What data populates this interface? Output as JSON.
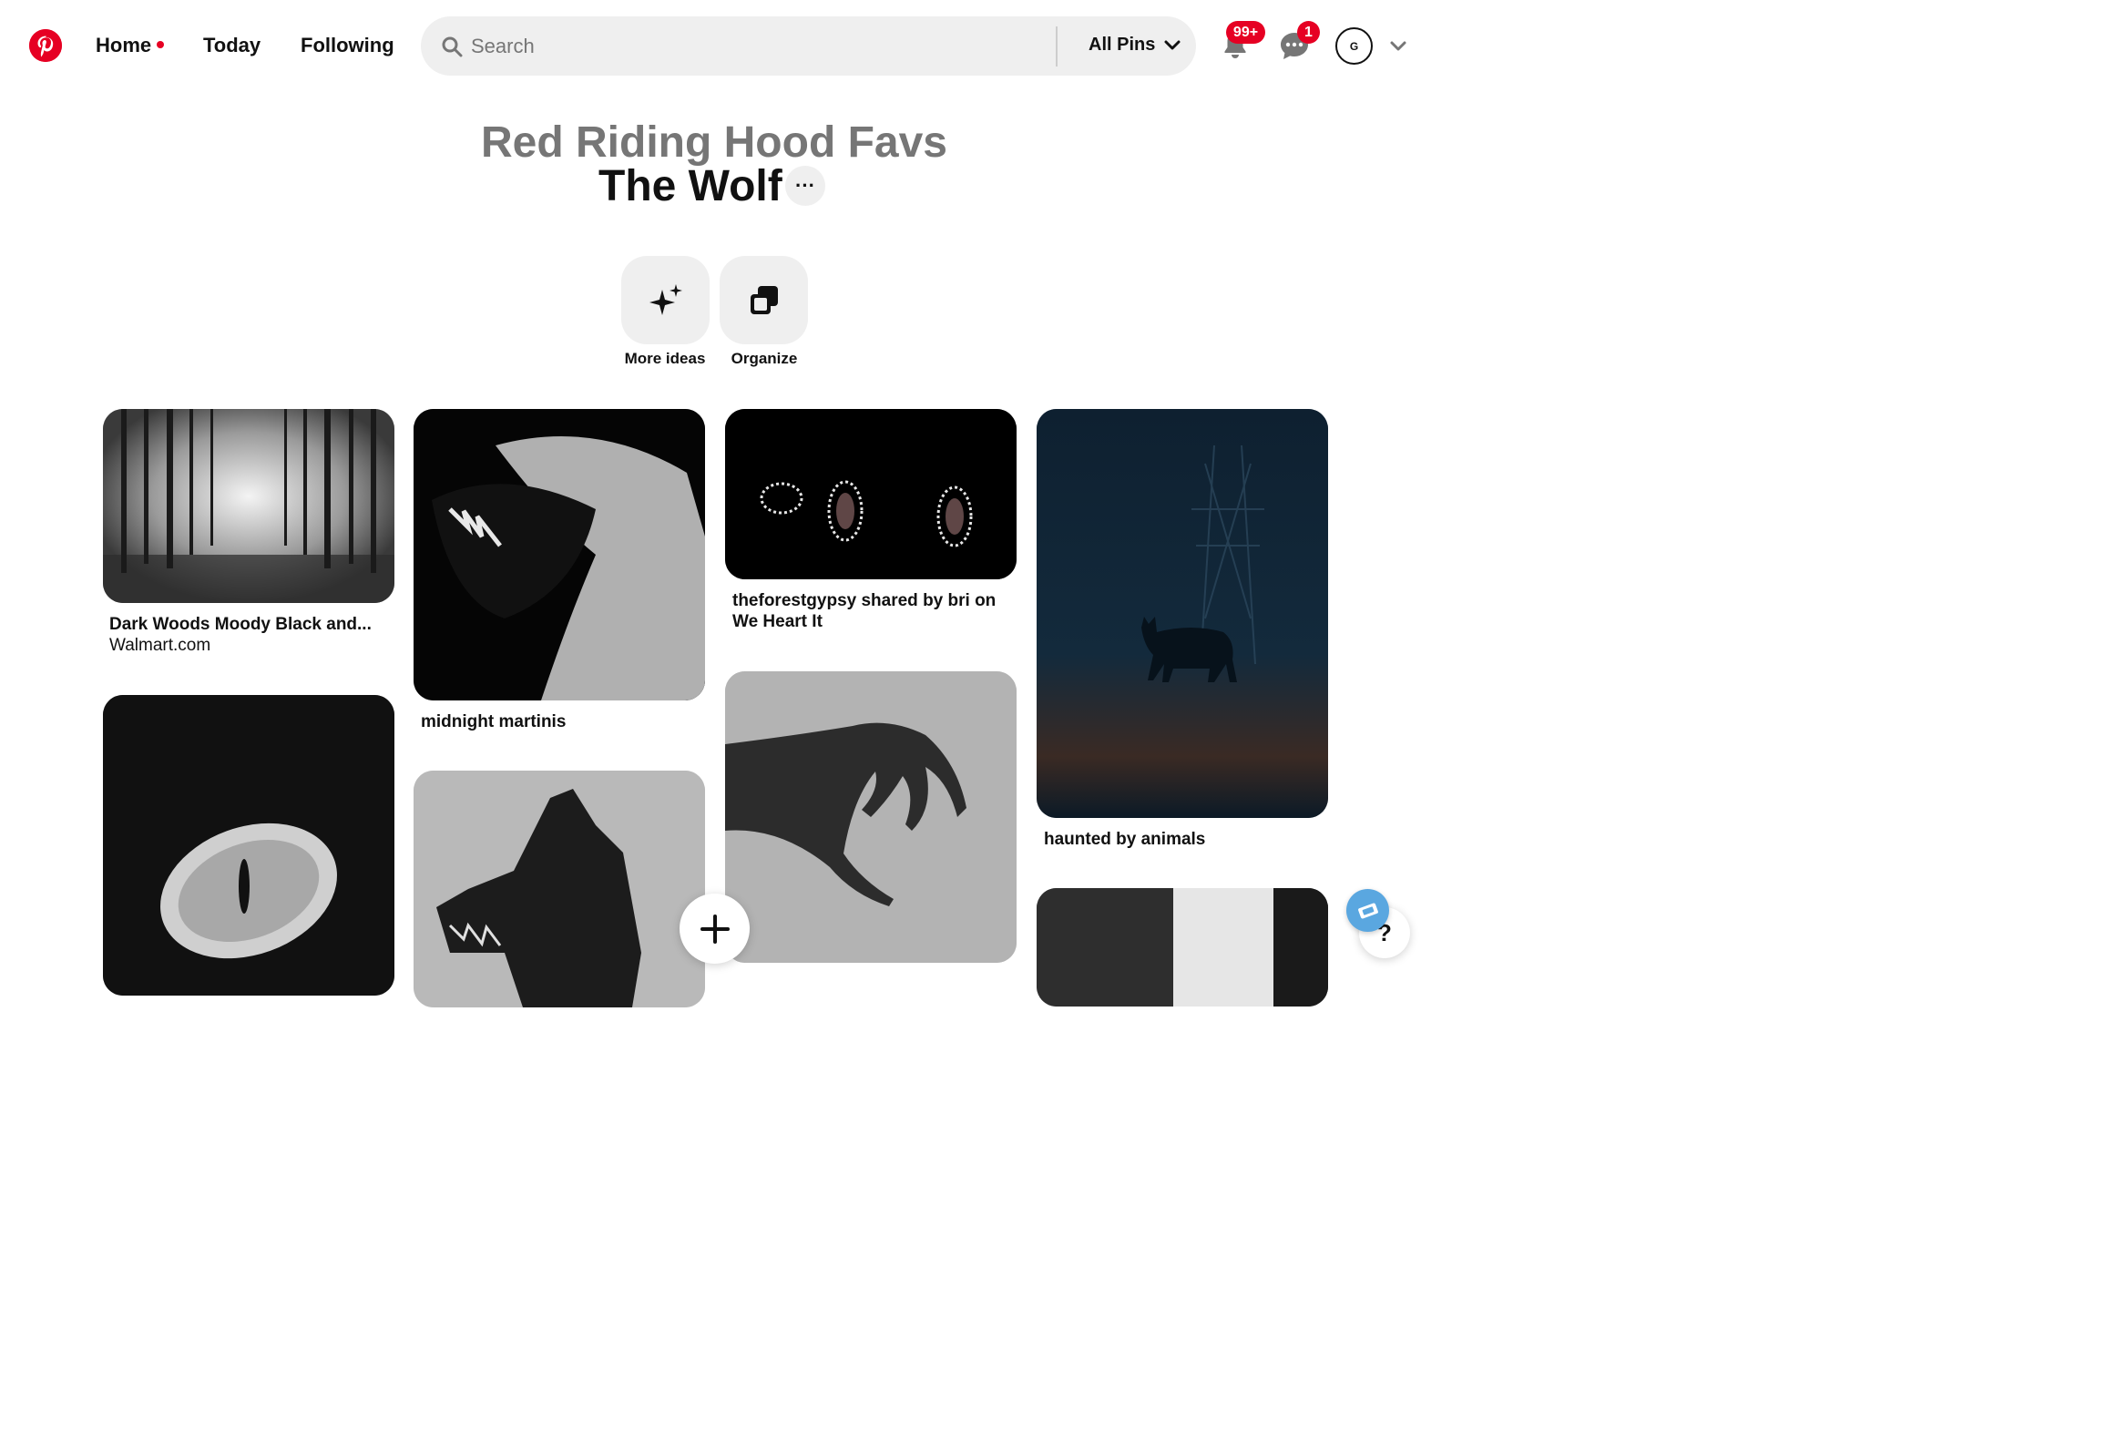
{
  "colors": {
    "brand": "#e60023",
    "text": "#111111",
    "muted": "#767676",
    "chip": "#efefef"
  },
  "header": {
    "logo_icon": "pinterest-logo-icon",
    "nav": {
      "home": "Home",
      "today": "Today",
      "following": "Following"
    },
    "search": {
      "placeholder": "Search",
      "filter": "All Pins"
    },
    "notifications_badge": "99+",
    "messages_badge": "1",
    "avatar_initial": "G"
  },
  "board": {
    "parent": "Red Riding Hood Favs",
    "title": "The Wolf",
    "more": "···",
    "actions": {
      "more_ideas": "More ideas",
      "organize": "Organize"
    }
  },
  "pins": [
    {
      "title": "Dark Woods Moody Black and...",
      "source": "Walmart.com"
    },
    {
      "title": "midnight martinis"
    },
    {
      "title": "theforestgypsy shared by bri on",
      "title2": "We Heart It"
    },
    {
      "title": "haunted by animals"
    }
  ],
  "floating": {
    "help": "?"
  }
}
